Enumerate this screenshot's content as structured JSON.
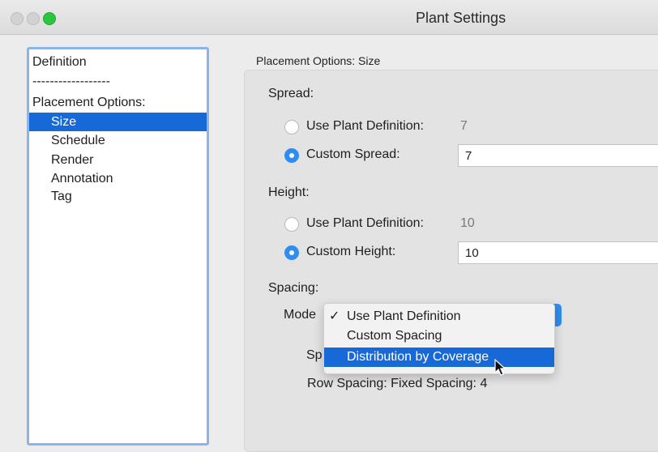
{
  "window": {
    "title": "Plant Settings"
  },
  "sidebar": {
    "items": [
      {
        "label": "Definition"
      },
      {
        "label": "------------------"
      },
      {
        "label": "Placement Options:"
      },
      {
        "label": "Size",
        "selected": true
      },
      {
        "label": "Schedule"
      },
      {
        "label": "Render"
      },
      {
        "label": "Annotation"
      },
      {
        "label": "Tag"
      }
    ]
  },
  "main": {
    "pane_title": "Placement Options: Size",
    "spread": {
      "header": "Spread:",
      "use_def_label": "Use Plant Definition:",
      "use_def_value": "7",
      "custom_label": "Custom Spread:",
      "custom_value": "7",
      "selected": "custom"
    },
    "height": {
      "header": "Height:",
      "use_def_label": "Use Plant Definition:",
      "use_def_value": "10",
      "custom_label": "Custom Height:",
      "custom_value": "10",
      "selected": "custom"
    },
    "spacing": {
      "header": "Spacing:",
      "mode_label": "Mode",
      "sp_label_partial": "Sp",
      "row_spacing": "Row Spacing:  Fixed Spacing: 4"
    },
    "mode_menu": {
      "items": [
        {
          "label": "Use Plant Definition",
          "checked": true,
          "check": "✓"
        },
        {
          "label": "Custom Spacing"
        },
        {
          "label": "Distribution by Coverage",
          "highlighted": true
        }
      ]
    }
  },
  "colors": {
    "accent": "#1769d7",
    "radio_on": "#2f8df0",
    "sidebar_border": "#8ab4ea"
  }
}
